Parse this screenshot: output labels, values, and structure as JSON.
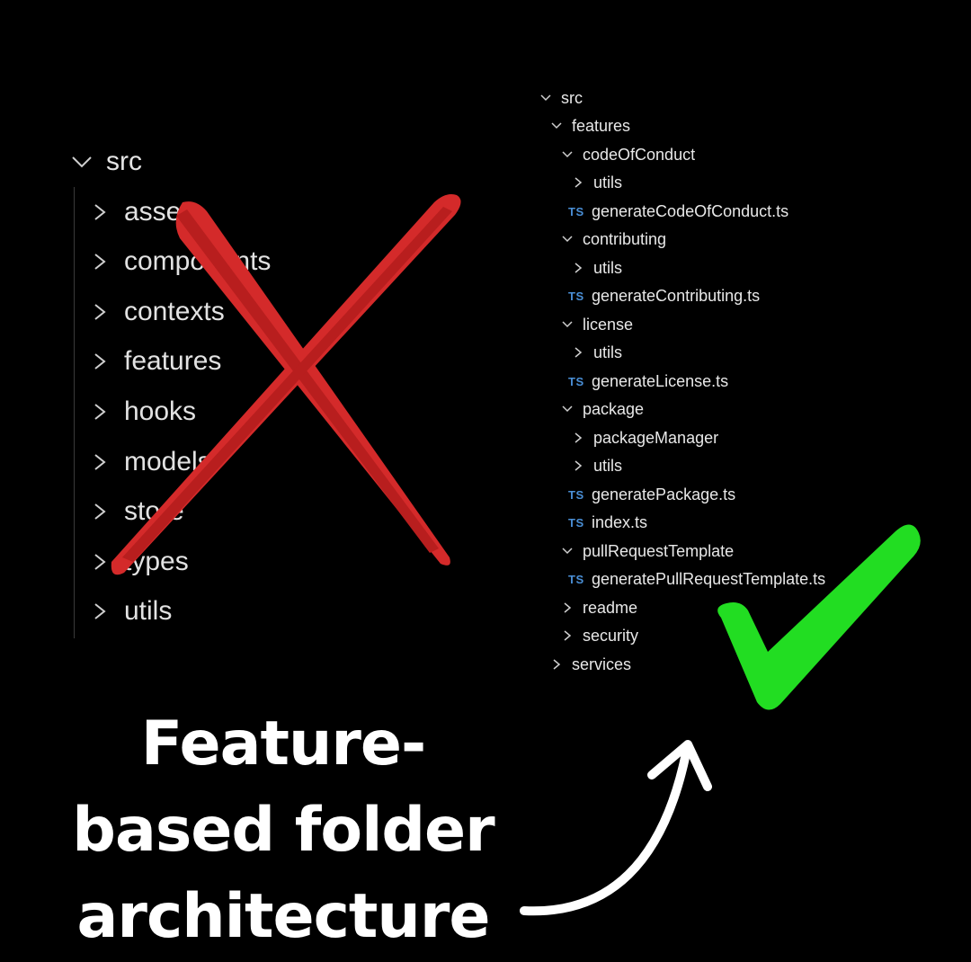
{
  "left_tree": {
    "root": "src",
    "items": [
      "assets",
      "components",
      "contexts",
      "features",
      "hooks",
      "models",
      "store",
      "types",
      "utils"
    ]
  },
  "right_tree": {
    "items": [
      {
        "label": "src",
        "kind": "folder-open"
      },
      {
        "label": "features",
        "kind": "folder-open"
      },
      {
        "label": "codeOfConduct",
        "kind": "folder-open"
      },
      {
        "label": "utils",
        "kind": "folder-closed"
      },
      {
        "label": "generateCodeOfConduct.ts",
        "kind": "ts-file",
        "badge": "TS"
      },
      {
        "label": "contributing",
        "kind": "folder-open"
      },
      {
        "label": "utils",
        "kind": "folder-closed"
      },
      {
        "label": "generateContributing.ts",
        "kind": "ts-file",
        "badge": "TS"
      },
      {
        "label": "license",
        "kind": "folder-open"
      },
      {
        "label": "utils",
        "kind": "folder-closed"
      },
      {
        "label": "generateLicense.ts",
        "kind": "ts-file",
        "badge": "TS"
      },
      {
        "label": "package",
        "kind": "folder-open"
      },
      {
        "label": "packageManager",
        "kind": "folder-closed"
      },
      {
        "label": "utils",
        "kind": "folder-closed"
      },
      {
        "label": "generatePackage.ts",
        "kind": "ts-file",
        "badge": "TS"
      },
      {
        "label": "index.ts",
        "kind": "ts-file",
        "badge": "TS"
      },
      {
        "label": "pullRequestTemplate",
        "kind": "folder-open"
      },
      {
        "label": "generatePullRequestTemplate.ts",
        "kind": "ts-file",
        "badge": "TS"
      },
      {
        "label": "readme",
        "kind": "folder-closed"
      },
      {
        "label": "security",
        "kind": "folder-closed"
      },
      {
        "label": "services",
        "kind": "folder-closed"
      }
    ]
  },
  "caption": {
    "line1": "Feature-",
    "line2": "based folder",
    "line3": "architecture"
  },
  "icons": {
    "bad_mark": "red-x-icon",
    "good_mark": "green-checkmark-icon",
    "pointer": "curved-arrow-icon"
  },
  "colors": {
    "background": "#000000",
    "x_mark": "#d42a2a",
    "check_mark": "#22dd22",
    "ts_badge": "#4a8fd6",
    "caption": "#ffffff"
  }
}
